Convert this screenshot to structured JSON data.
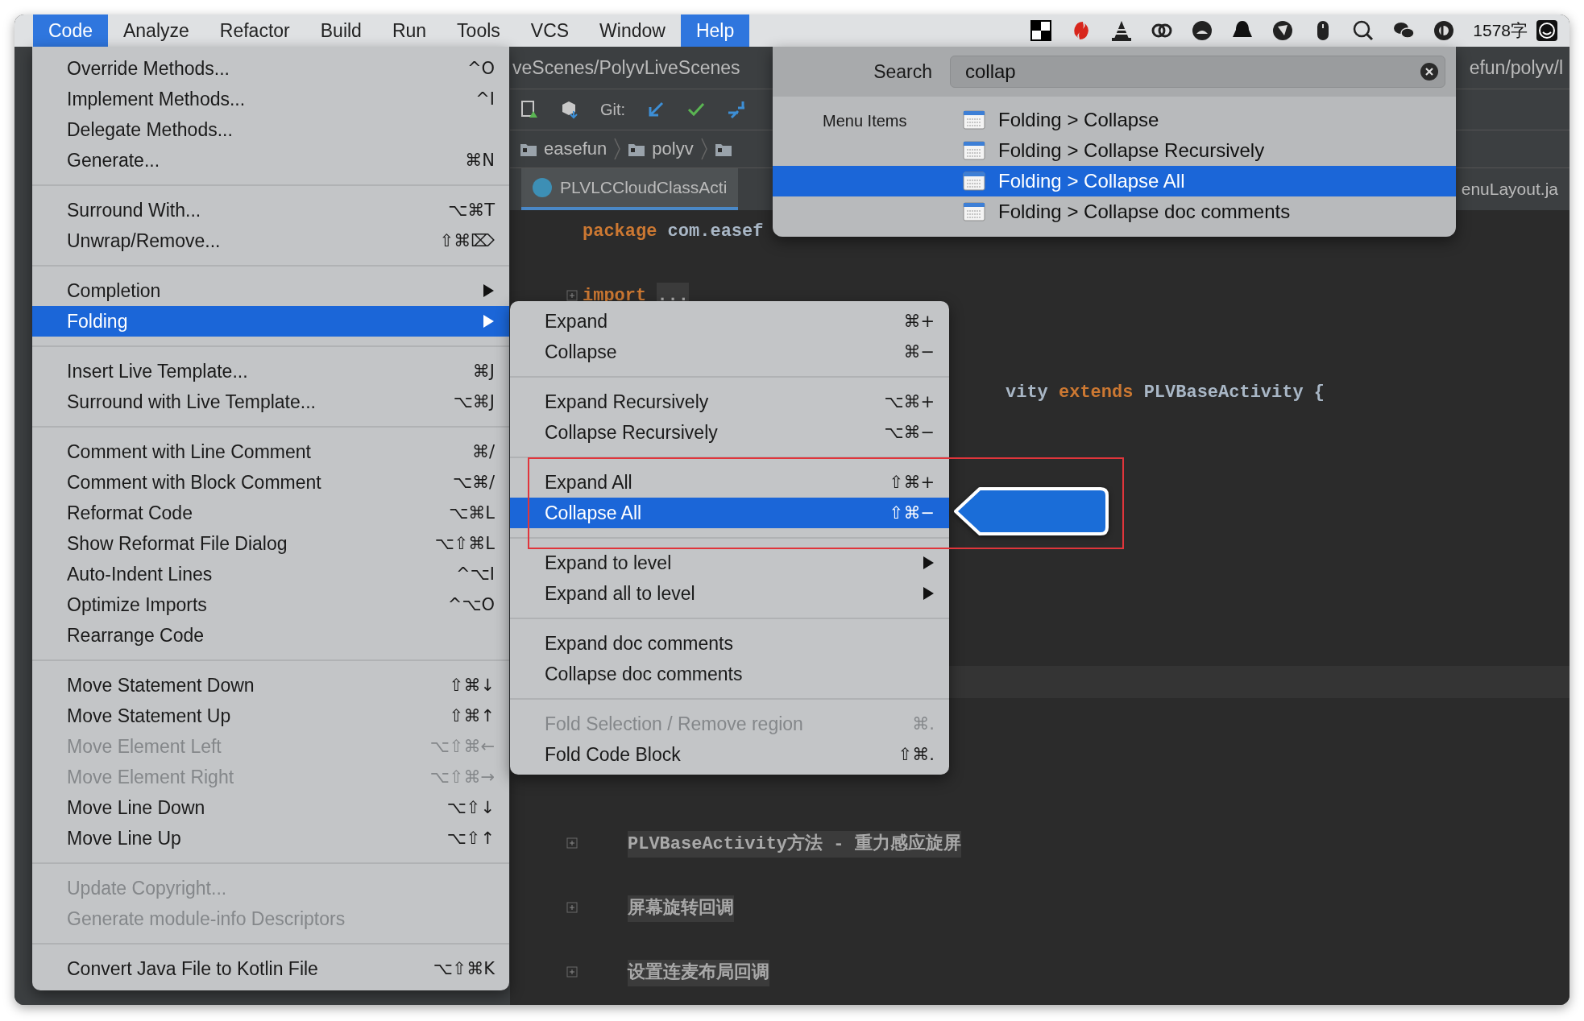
{
  "menubar": {
    "items": [
      {
        "label": "Code",
        "selected": true
      },
      {
        "label": "Analyze",
        "selected": false
      },
      {
        "label": "Refactor",
        "selected": false
      },
      {
        "label": "Build",
        "selected": false
      },
      {
        "label": "Run",
        "selected": false
      },
      {
        "label": "Tools",
        "selected": false
      },
      {
        "label": "VCS",
        "selected": false
      },
      {
        "label": "Window",
        "selected": false
      },
      {
        "label": "Help",
        "selected": true
      }
    ],
    "status_text": "1578字"
  },
  "editor": {
    "path_left": "veScenes/PolyvLiveScenes",
    "path_right": "efun/polyv/l",
    "git_label": "Git:",
    "breadcrumbs": [
      "easefun",
      "polyv"
    ],
    "tabs": [
      {
        "label": "PLVLCCloudClassActi",
        "selected": true
      },
      {
        "label": "enuLayout.ja",
        "selected": false
      }
    ],
    "lines": [
      {
        "kind": "code",
        "fold": false,
        "tokens": [
          {
            "kind": "keyword",
            "text": "package"
          },
          {
            "kind": "plain",
            "text": " com.easef"
          }
        ]
      },
      {
        "kind": "blank"
      },
      {
        "kind": "code",
        "fold": true,
        "tokens": [
          {
            "kind": "keyword",
            "text": "import"
          },
          {
            "kind": "folded",
            "text": "..."
          }
        ]
      },
      {
        "kind": "blank"
      },
      {
        "kind": "blank"
      },
      {
        "kind": "covered_start",
        "fold": false,
        "tokens": [
          {
            "kind": "plain",
            "text": "vity "
          },
          {
            "kind": "keyword",
            "text": "extends"
          },
          {
            "kind": "plain",
            "text": " PLVBaseActivity {"
          }
        ]
      },
      {
        "kind": "blank"
      },
      {
        "kind": "blank"
      },
      {
        "kind": "blank"
      },
      {
        "kind": "blank"
      },
      {
        "kind": "blank"
      },
      {
        "kind": "blank"
      },
      {
        "kind": "blank"
      },
      {
        "kind": "blank"
      },
      {
        "kind": "current"
      },
      {
        "kind": "blank"
      },
      {
        "kind": "blank"
      },
      {
        "kind": "blank"
      },
      {
        "kind": "blank"
      },
      {
        "kind": "folded",
        "fold": true,
        "tokens": [
          {
            "kind": "folded",
            "text": "PLVBaseActivity方法 - 重力感应旋屏"
          }
        ]
      },
      {
        "kind": "blank"
      },
      {
        "kind": "folded",
        "fold": true,
        "tokens": [
          {
            "kind": "folded",
            "text": "屏幕旋转回调"
          }
        ]
      },
      {
        "kind": "blank"
      },
      {
        "kind": "folded",
        "fold": true,
        "tokens": [
          {
            "kind": "folded",
            "text": "设置连麦布局回调"
          }
        ]
      }
    ]
  },
  "code_menu": {
    "groups": [
      [
        {
          "label": "Override Methods...",
          "shortcut": "^O",
          "disabled": false,
          "selected": false,
          "submenu": false
        },
        {
          "label": "Implement Methods...",
          "shortcut": "^I",
          "disabled": false,
          "selected": false,
          "submenu": false
        },
        {
          "label": "Delegate Methods...",
          "disabled": false,
          "selected": false,
          "submenu": false
        },
        {
          "label": "Generate...",
          "shortcut": "⌘N",
          "disabled": false,
          "selected": false,
          "submenu": false
        }
      ],
      [
        {
          "label": "Surround With...",
          "shortcut": "⌥⌘T",
          "disabled": false,
          "selected": false,
          "submenu": false
        },
        {
          "label": "Unwrap/Remove...",
          "shortcut": "⇧⌘⌦",
          "disabled": false,
          "selected": false,
          "submenu": false
        }
      ],
      [
        {
          "label": "Completion",
          "disabled": false,
          "selected": false,
          "submenu": true
        },
        {
          "label": "Folding",
          "disabled": false,
          "selected": true,
          "submenu": true
        }
      ],
      [
        {
          "label": "Insert Live Template...",
          "shortcut": "⌘J",
          "disabled": false,
          "selected": false,
          "submenu": false
        },
        {
          "label": "Surround with Live Template...",
          "shortcut": "⌥⌘J",
          "disabled": false,
          "selected": false,
          "submenu": false
        }
      ],
      [
        {
          "label": "Comment with Line Comment",
          "shortcut": "⌘/",
          "disabled": false,
          "selected": false,
          "submenu": false
        },
        {
          "label": "Comment with Block Comment",
          "shortcut": "⌥⌘/",
          "disabled": false,
          "selected": false,
          "submenu": false
        },
        {
          "label": "Reformat Code",
          "shortcut": "⌥⌘L",
          "disabled": false,
          "selected": false,
          "submenu": false
        },
        {
          "label": "Show Reformat File Dialog",
          "shortcut": "⌥⇧⌘L",
          "disabled": false,
          "selected": false,
          "submenu": false
        },
        {
          "label": "Auto-Indent Lines",
          "shortcut": "^⌥I",
          "disabled": false,
          "selected": false,
          "submenu": false
        },
        {
          "label": "Optimize Imports",
          "shortcut": "^⌥O",
          "disabled": false,
          "selected": false,
          "submenu": false
        },
        {
          "label": "Rearrange Code",
          "disabled": false,
          "selected": false,
          "submenu": false
        }
      ],
      [
        {
          "label": "Move Statement Down",
          "shortcut": "⇧⌘↓",
          "disabled": false,
          "selected": false,
          "submenu": false
        },
        {
          "label": "Move Statement Up",
          "shortcut": "⇧⌘↑",
          "disabled": false,
          "selected": false,
          "submenu": false
        },
        {
          "label": "Move Element Left",
          "shortcut": "⌥⇧⌘←",
          "disabled": true,
          "selected": false,
          "submenu": false
        },
        {
          "label": "Move Element Right",
          "shortcut": "⌥⇧⌘→",
          "disabled": true,
          "selected": false,
          "submenu": false
        },
        {
          "label": "Move Line Down",
          "shortcut": "⌥⇧↓",
          "disabled": false,
          "selected": false,
          "submenu": false
        },
        {
          "label": "Move Line Up",
          "shortcut": "⌥⇧↑",
          "disabled": false,
          "selected": false,
          "submenu": false
        }
      ],
      [
        {
          "label": "Update Copyright...",
          "disabled": true,
          "selected": false,
          "submenu": false
        },
        {
          "label": "Generate module-info Descriptors",
          "disabled": true,
          "selected": false,
          "submenu": false
        }
      ],
      [
        {
          "label": "Convert Java File to Kotlin File",
          "shortcut": "⌥⇧⌘K",
          "disabled": false,
          "selected": false,
          "submenu": false
        }
      ]
    ]
  },
  "folding_submenu": {
    "groups": [
      [
        {
          "label": "Expand",
          "shortcut": "⌘+",
          "disabled": false,
          "selected": false,
          "submenu": false
        },
        {
          "label": "Collapse",
          "shortcut": "⌘−",
          "disabled": false,
          "selected": false,
          "submenu": false
        }
      ],
      [
        {
          "label": "Expand Recursively",
          "shortcut": "⌥⌘+",
          "disabled": false,
          "selected": false,
          "submenu": false
        },
        {
          "label": "Collapse Recursively",
          "shortcut": "⌥⌘−",
          "disabled": false,
          "selected": false,
          "submenu": false
        }
      ],
      [
        {
          "label": "Expand All",
          "shortcut": "⇧⌘+",
          "disabled": false,
          "selected": false,
          "submenu": false
        },
        {
          "label": "Collapse All",
          "shortcut": "⇧⌘−",
          "disabled": false,
          "selected": true,
          "submenu": false
        }
      ],
      [
        {
          "label": "Expand to level",
          "disabled": false,
          "selected": false,
          "submenu": true
        },
        {
          "label": "Expand all to level",
          "disabled": false,
          "selected": false,
          "submenu": true
        }
      ],
      [
        {
          "label": "Expand doc comments",
          "disabled": false,
          "selected": false,
          "submenu": false
        },
        {
          "label": "Collapse doc comments",
          "disabled": false,
          "selected": false,
          "submenu": false
        }
      ],
      [
        {
          "label": "Fold Selection / Remove region",
          "shortcut": "⌘.",
          "disabled": true,
          "selected": false,
          "submenu": false
        },
        {
          "label": "Fold Code Block",
          "shortcut": "⇧⌘.",
          "disabled": false,
          "selected": false,
          "submenu": false
        }
      ]
    ]
  },
  "help_search": {
    "label": "Search",
    "value": "collap",
    "section_label": "Menu Items",
    "results": [
      {
        "label": "Folding > Collapse",
        "selected": false
      },
      {
        "label": "Folding > Collapse Recursively",
        "selected": false
      },
      {
        "label": "Folding > Collapse All",
        "selected": true
      },
      {
        "label": "Folding > Collapse doc comments",
        "selected": false
      }
    ]
  }
}
